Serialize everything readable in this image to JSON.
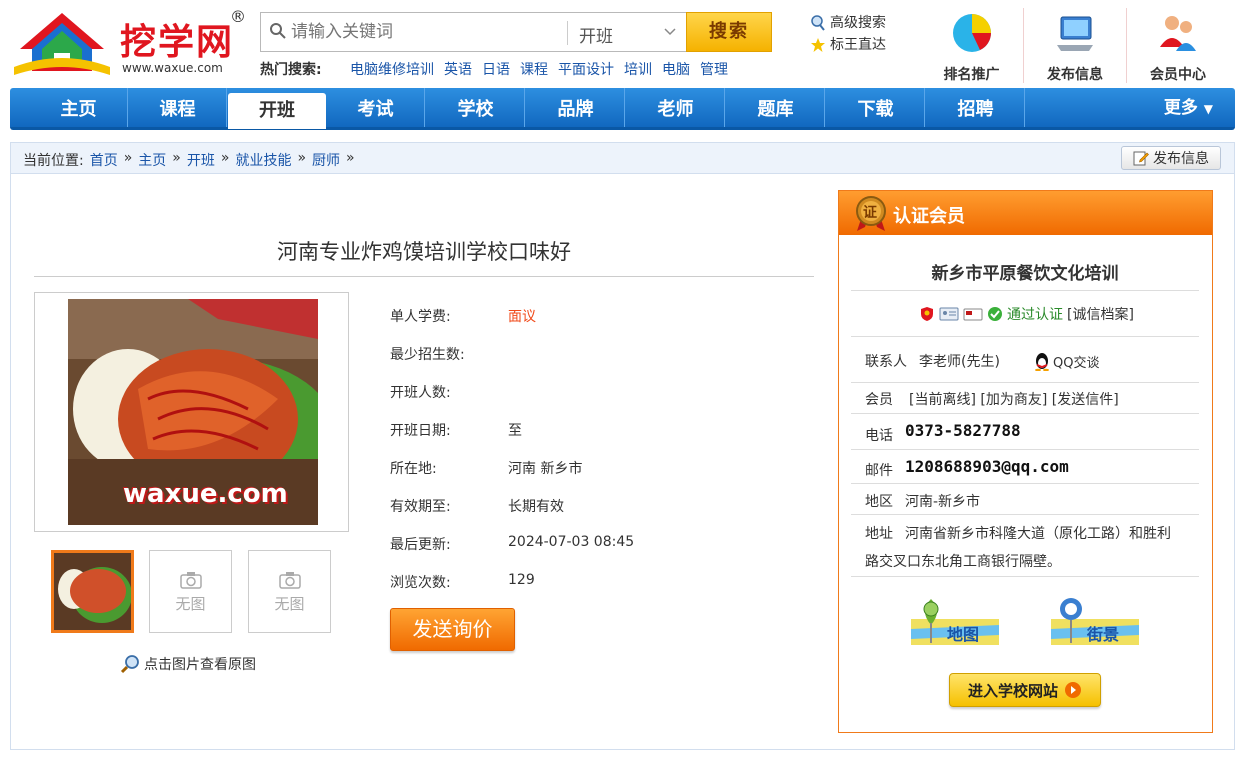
{
  "header": {
    "logo_text": "挖学网",
    "logo_reg": "®",
    "logo_url": "www.waxue.com",
    "search_placeholder": "请输入关键词",
    "search_category": "开班",
    "search_button": "搜索",
    "hot_label": "热门搜索:",
    "hot_links": [
      "电脑维修培训",
      "英语",
      "日语",
      "课程",
      "平面设计",
      "培训",
      "电脑",
      "管理"
    ],
    "advanced_search": "高级搜索",
    "direct": "标王直达",
    "icons": [
      {
        "label": "排名推广",
        "icon": "pie-chart-icon"
      },
      {
        "label": "发布信息",
        "icon": "computer-icon"
      },
      {
        "label": "会员中心",
        "icon": "users-icon"
      }
    ]
  },
  "nav": {
    "items": [
      "主页",
      "课程",
      "开班",
      "考试",
      "学校",
      "品牌",
      "老师",
      "题库",
      "下载",
      "招聘"
    ],
    "active": "开班",
    "more": "更多"
  },
  "breadcrumb": {
    "label": "当前位置:",
    "items": [
      "首页",
      "主页",
      "开班",
      "就业技能",
      "厨师"
    ],
    "sep": "»",
    "publish": "发布信息"
  },
  "listing": {
    "title": "河南专业炸鸡馍培训学校口味好",
    "watermark": "waxue.com",
    "no_image": "无图",
    "zoom_hint": "点击图片查看原图",
    "fields": [
      {
        "label": "单人学费:",
        "value": "面议"
      },
      {
        "label": "最少招生数:",
        "value": ""
      },
      {
        "label": "开班人数:",
        "value": ""
      },
      {
        "label": "开班日期:",
        "value": " 至"
      },
      {
        "label": "所在地:",
        "value": "河南 新乡市"
      },
      {
        "label": "有效期至:",
        "value": "长期有效"
      },
      {
        "label": "最后更新:",
        "value": "2024-07-03 08:45"
      },
      {
        "label": "浏览次数:",
        "value": "129"
      }
    ],
    "send_button": "发送询价"
  },
  "member": {
    "header": "认证会员",
    "badge": "证",
    "company": "新乡市平原餐饮文化培训",
    "verified": "通过认证",
    "archive": "[诚信档案]",
    "contact_label": "联系人",
    "contact_value": "李老师(先生)",
    "qq": "QQ交谈",
    "member_label": "会员",
    "member_links": "[当前离线] [加为商友] [发送信件]",
    "phone_label": "电话",
    "phone": "0373-5827788",
    "email_label": "邮件",
    "email": "1208688903@qq.com",
    "area_label": "地区",
    "area": "河南-新乡市",
    "addr_label": "地址",
    "addr_line1": "河南省新乡市科隆大道（原化工路）和胜利",
    "addr_line2": "路交叉口东北角工商银行隔壁。",
    "map": "地图",
    "street": "街景",
    "enter_site": "进入学校网站"
  }
}
